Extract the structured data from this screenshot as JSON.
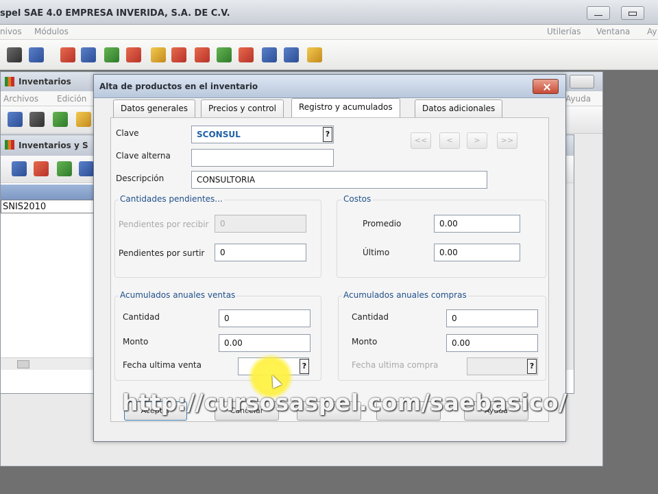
{
  "app": {
    "title": "spel SAE 4.0 EMPRESA INVERIDA, S.A. DE C.V.",
    "menu": {
      "archivos": "nivos",
      "modulos": "Módulos",
      "utilerias": "Utilerías",
      "ventana": "Ventana",
      "ayuda": "Ay"
    }
  },
  "inv_window": {
    "title": "Inventarios",
    "menu": {
      "archivos": "Archivos",
      "edicion": "Edición",
      "ayuda": "Ayuda"
    }
  },
  "sub_window": {
    "title": "Inventarios y S",
    "row_value": "SNIS2010"
  },
  "dialog": {
    "title": "Alta de productos en el inventario",
    "tabs": [
      "Datos generales",
      "Precios y control",
      "Registro y acumulados",
      "Datos adicionales"
    ],
    "active_tab": 2,
    "fields": {
      "clave_label": "Clave",
      "clave_value": "SCONSUL",
      "clave_alterna_label": "Clave alterna",
      "clave_alterna_value": "",
      "descripcion_label": "Descripción",
      "descripcion_value": "CONSULTORIA"
    },
    "nav": [
      "<<",
      "<",
      ">",
      ">>"
    ],
    "pendientes": {
      "title": "Cantidades pendientes...",
      "recibir_label": "Pendientes por recibir",
      "recibir_value": "0",
      "surtir_label": "Pendientes por surtir",
      "surtir_value": "0"
    },
    "costos": {
      "title": "Costos",
      "promedio_label": "Promedio",
      "promedio_value": "0.00",
      "ultimo_label": "Último",
      "ultimo_value": "0.00"
    },
    "ventas": {
      "title": "Acumulados anuales ventas",
      "cantidad_label": "Cantidad",
      "cantidad_value": "0",
      "monto_label": "Monto",
      "monto_value": "0.00",
      "fecha_label": "Fecha ultima venta",
      "fecha_value": ""
    },
    "compras": {
      "title": "Acumulados anuales compras",
      "cantidad_label": "Cantidad",
      "cantidad_value": "0",
      "monto_label": "Monto",
      "monto_value": "0.00",
      "fecha_label": "Fecha ultima compra",
      "fecha_value": ""
    },
    "buttons": {
      "aceptar": "Aceptar",
      "cancelar": "Cancelar",
      "ayuda": "Ayuda"
    }
  },
  "overlay_url": "http://cursosaspel.com/saebasico/"
}
